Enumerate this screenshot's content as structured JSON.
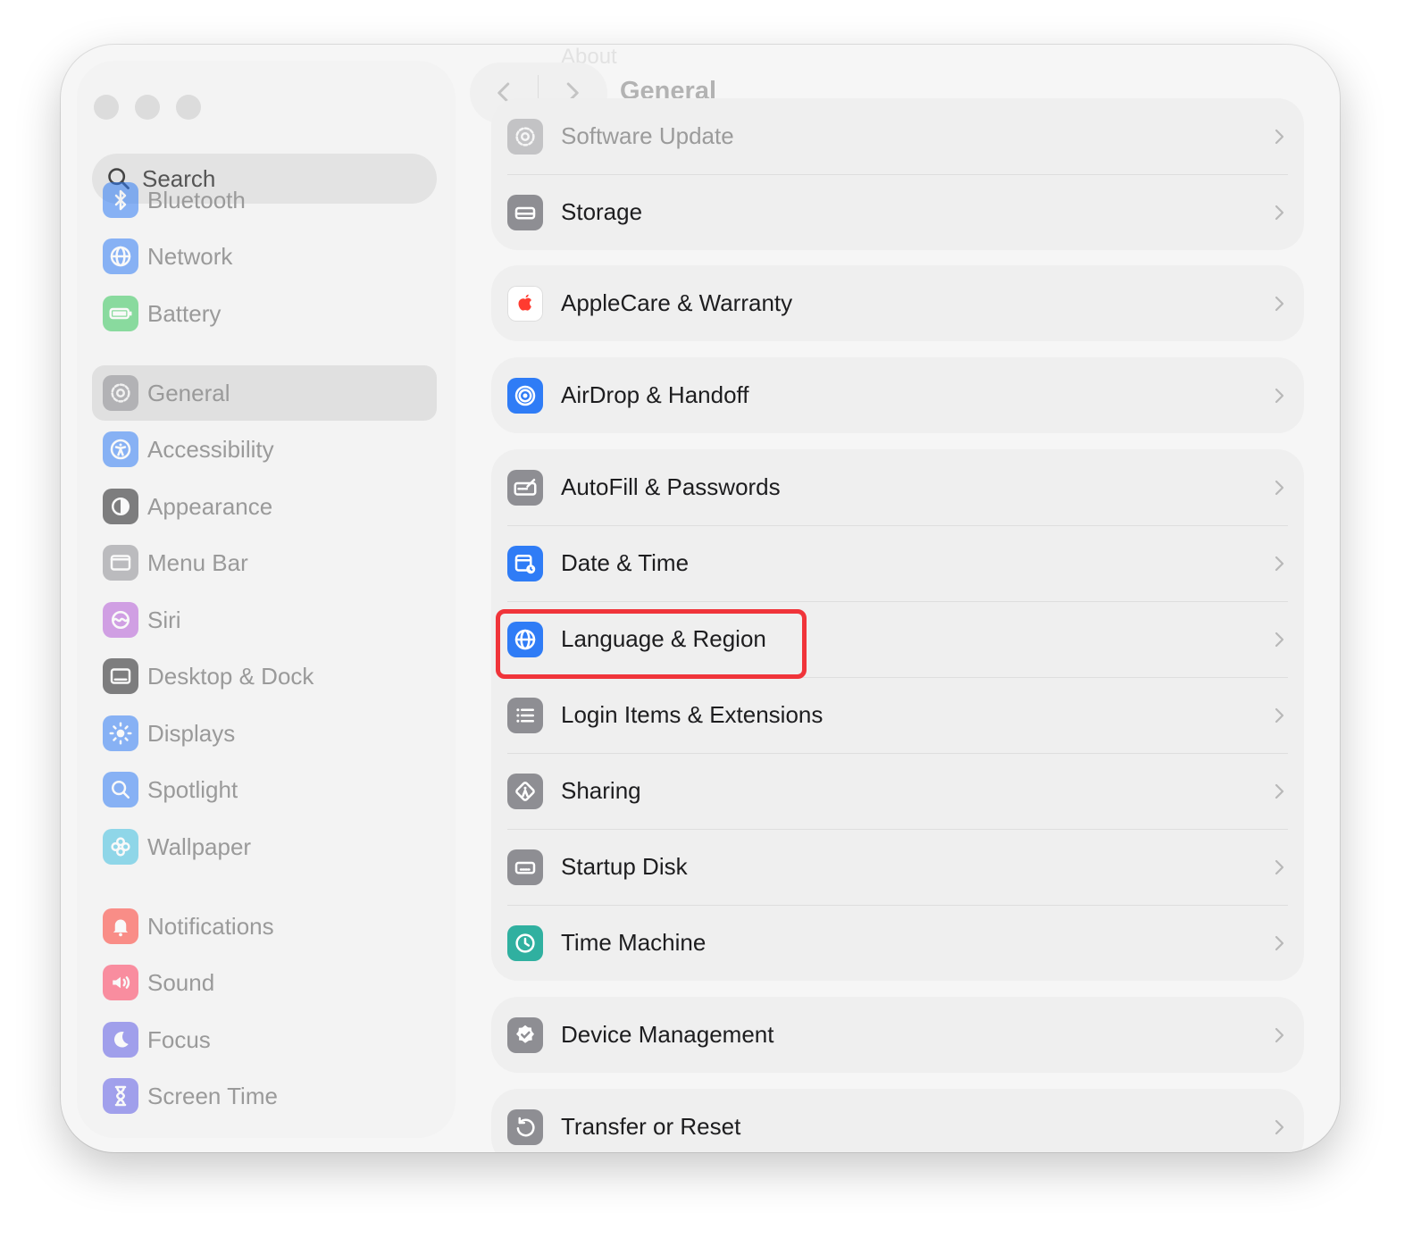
{
  "sidebar": {
    "search_placeholder": "Search",
    "items": [
      {
        "label": "Bluetooth",
        "icon": "bluetooth-icon",
        "color": "#2f7cf6"
      },
      {
        "label": "Network",
        "icon": "globe-icon",
        "color": "#2f7cf6"
      },
      {
        "label": "Battery",
        "icon": "battery-icon",
        "color": "#34c759"
      },
      {
        "label": "General",
        "icon": "gear-icon",
        "color": "#8e8e93",
        "selected": true
      },
      {
        "label": "Accessibility",
        "icon": "accessibility-icon",
        "color": "#2f7cf6"
      },
      {
        "label": "Appearance",
        "icon": "appearance-icon",
        "color": "#1d1d1f"
      },
      {
        "label": "Menu Bar",
        "icon": "menubar-icon",
        "color": "#8e8e93"
      },
      {
        "label": "Siri",
        "icon": "siri-icon",
        "color": "#b45cd6"
      },
      {
        "label": "Desktop & Dock",
        "icon": "dock-icon",
        "color": "#1d1d1f"
      },
      {
        "label": "Displays",
        "icon": "sun-icon",
        "color": "#2f7cf6"
      },
      {
        "label": "Spotlight",
        "icon": "spotlight-icon",
        "color": "#2f7cf6"
      },
      {
        "label": "Wallpaper",
        "icon": "flower-icon",
        "color": "#3fbfe0"
      },
      {
        "label": "Notifications",
        "icon": "bell-icon",
        "color": "#ff3b30"
      },
      {
        "label": "Sound",
        "icon": "speaker-icon",
        "color": "#ff3b5c"
      },
      {
        "label": "Focus",
        "icon": "moon-icon",
        "color": "#5e5ce6"
      },
      {
        "label": "Screen Time",
        "icon": "hourglass-icon",
        "color": "#5e5ce6"
      }
    ]
  },
  "header": {
    "title": "General",
    "about_label": "About"
  },
  "groups": [
    [
      {
        "label": "Software Update",
        "icon": "gear-icon",
        "color": "#8e8e93",
        "dimmed": true
      },
      {
        "label": "Storage",
        "icon": "drive-icon",
        "color": "#8e8e93"
      }
    ],
    [
      {
        "label": "AppleCare & Warranty",
        "icon": "apple-icon",
        "color": "#ff3b30"
      }
    ],
    [
      {
        "label": "AirDrop & Handoff",
        "icon": "airdrop-icon",
        "color": "#2f7cf6"
      }
    ],
    [
      {
        "label": "AutoFill & Passwords",
        "icon": "keyboard-icon",
        "color": "#8e8e93"
      },
      {
        "label": "Date & Time",
        "icon": "calendar-clock-icon",
        "color": "#2f7cf6"
      },
      {
        "label": "Language & Region",
        "icon": "globe-icon",
        "color": "#2f7cf6"
      },
      {
        "label": "Login Items & Extensions",
        "icon": "list-icon",
        "color": "#8e8e93"
      },
      {
        "label": "Sharing",
        "icon": "sharing-icon",
        "color": "#8e8e93"
      },
      {
        "label": "Startup Disk",
        "icon": "disk-icon",
        "color": "#8e8e93"
      },
      {
        "label": "Time Machine",
        "icon": "timemachine-icon",
        "color": "#30b0a0"
      }
    ],
    [
      {
        "label": "Device Management",
        "icon": "badge-check-icon",
        "color": "#8e8e93"
      }
    ],
    [
      {
        "label": "Transfer or Reset",
        "icon": "reset-icon",
        "color": "#8e8e93"
      }
    ]
  ],
  "highlight_color": "#f0343a"
}
